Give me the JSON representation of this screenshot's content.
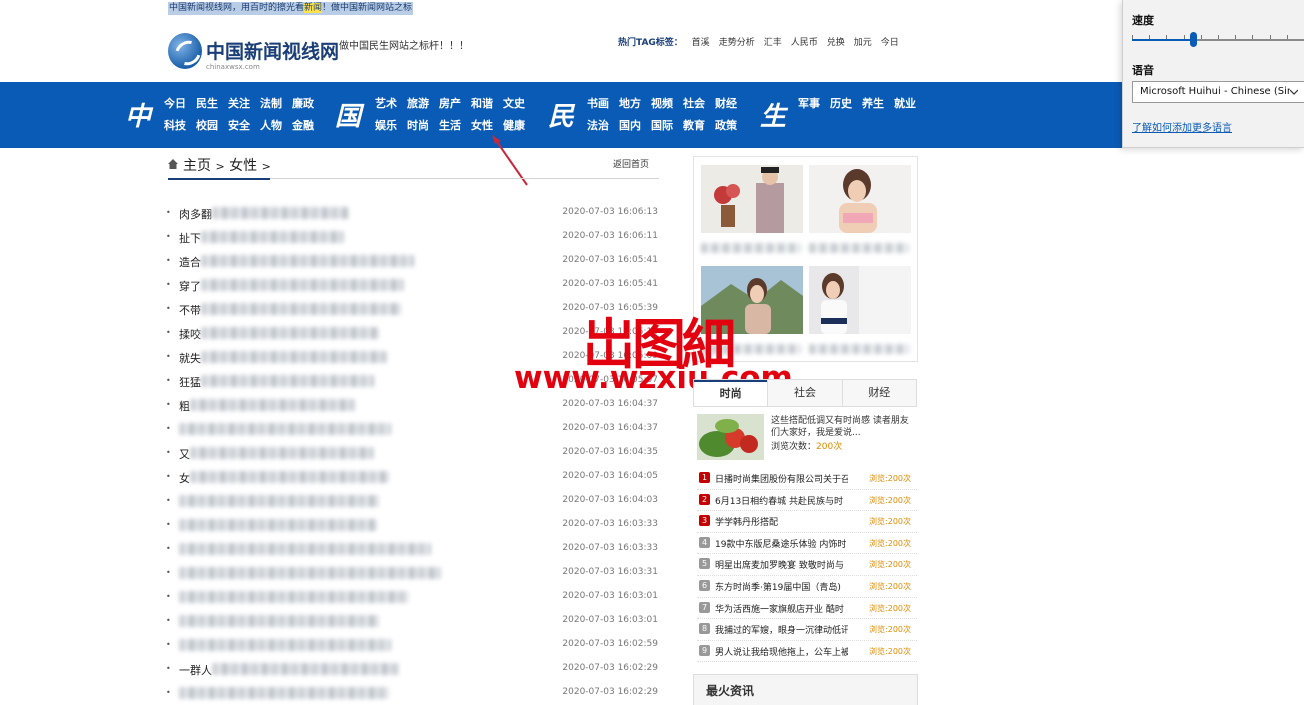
{
  "top_bar": {
    "text_before": "中国新闻视线网，用百时的擦光看",
    "text_highlight": "新闻",
    "text_after": "！做中国新闻网站之标"
  },
  "header": {
    "logo_cn": "中国新闻视线网",
    "logo_en": "chinaxwsx.com",
    "slogan": "做中国民生网站之标杆！！！",
    "tags_title": "热门TAG标签：",
    "tags": [
      "首溪",
      "走势分析",
      "汇丰",
      "人民币",
      "兑换",
      "加元",
      "今日"
    ]
  },
  "nav": {
    "big_chars": [
      "中",
      "国",
      "民",
      "生"
    ],
    "group1": [
      "今日",
      "民生",
      "关注",
      "法制",
      "廉政",
      "科技",
      "校园",
      "安全",
      "人物",
      "金融"
    ],
    "group2": [
      "艺术",
      "旅游",
      "房产",
      "和谐",
      "文史",
      "娱乐",
      "时尚",
      "生活",
      "女性",
      "健康"
    ],
    "group3": [
      "书画",
      "地方",
      "视频",
      "社会",
      "财经",
      "法治",
      "国内",
      "国际",
      "教育",
      "政策"
    ],
    "group4": [
      "军事",
      "历史",
      "养生",
      "就业"
    ]
  },
  "breadcrumb": {
    "home": "主页",
    "sep": ">",
    "current": "女性",
    "back": "返回首页"
  },
  "articles": [
    {
      "prefix": "肉多翻",
      "date": "2020-07-03 16:06:13"
    },
    {
      "prefix": "扯下",
      "date": "2020-07-03 16:06:11"
    },
    {
      "prefix": "造合",
      "date": "2020-07-03 16:05:41"
    },
    {
      "prefix": "穿了",
      "date": "2020-07-03 16:05:41"
    },
    {
      "prefix": "不带",
      "date": "2020-07-03 16:05:39"
    },
    {
      "prefix": "揉咬",
      "date": "2020-07-03 16:05:13"
    },
    {
      "prefix": "就失",
      "date": "2020-07-03 16:05:09"
    },
    {
      "prefix": "狂猛",
      "date": "2020-07-03 16:05:07"
    },
    {
      "prefix": "粗",
      "date": "2020-07-03 16:04:37"
    },
    {
      "prefix": "",
      "date": "2020-07-03 16:04:37"
    },
    {
      "prefix": "又",
      "date": "2020-07-03 16:04:35"
    },
    {
      "prefix": "女",
      "date": "2020-07-03 16:04:05"
    },
    {
      "prefix": "",
      "date": "2020-07-03 16:04:03"
    },
    {
      "prefix": "",
      "date": "2020-07-03 16:03:33"
    },
    {
      "prefix": "",
      "date": "2020-07-03 16:03:33"
    },
    {
      "prefix": "",
      "date": "2020-07-03 16:03:31"
    },
    {
      "prefix": "",
      "date": "2020-07-03 16:03:01"
    },
    {
      "prefix": "",
      "date": "2020-07-03 16:03:01"
    },
    {
      "prefix": "",
      "date": "2020-07-03 16:02:59"
    },
    {
      "prefix": "一群人",
      "date": "2020-07-03 16:02:29"
    },
    {
      "prefix": "",
      "date": "2020-07-03 16:02:29"
    }
  ],
  "watermark": {
    "cn": "岀图細",
    "url": "www.wzxiu.com"
  },
  "sidebar": {
    "tabs": [
      "时尚",
      "社会",
      "财经"
    ],
    "feature": {
      "text": "这些搭配低调又有时尚感 读者朋友们大家好，我是爱说...",
      "views_label": "浏览次数：",
      "views": "200次"
    },
    "rank": [
      {
        "num": "1",
        "title": "日播时尚集团股份有限公司关于召",
        "views": "浏览:200次"
      },
      {
        "num": "2",
        "title": "6月13日相约春城 共赴民族与时",
        "views": "浏览:200次"
      },
      {
        "num": "3",
        "title": "学学韩丹彤搭配",
        "views": "浏览:200次"
      },
      {
        "num": "4",
        "title": "19款中东版尼桑途乐体验 内饰时",
        "views": "浏览:200次"
      },
      {
        "num": "5",
        "title": "明星出席麦加罗晚宴 致敬时尚与",
        "views": "浏览:200次"
      },
      {
        "num": "6",
        "title": "东方时尚季·第19届中国（青岛)",
        "views": "浏览:200次"
      },
      {
        "num": "7",
        "title": "华为活西施一家旗舰店开业 酷时",
        "views": "浏览:200次"
      },
      {
        "num": "8",
        "title": "我捕过的军嫂，眼身一沉律动低讯",
        "views": "浏览:200次"
      },
      {
        "num": "9",
        "title": "男人说让我给现他拖上，公车上被",
        "views": "浏览:200次"
      }
    ],
    "hot_title": "最火资讯"
  },
  "speech_panel": {
    "speed_label": "速度",
    "speed_level": 0.35,
    "language_label": "语音",
    "voice": "Microsoft Huihui - Chinese (Simplified)",
    "link": "了解如何添加更多语言"
  },
  "colors": {
    "nav_blue": "#0a5bb5",
    "rank_red": "#c40000",
    "watermark_red": "#e3000f",
    "views_orange": "#e08a00"
  }
}
